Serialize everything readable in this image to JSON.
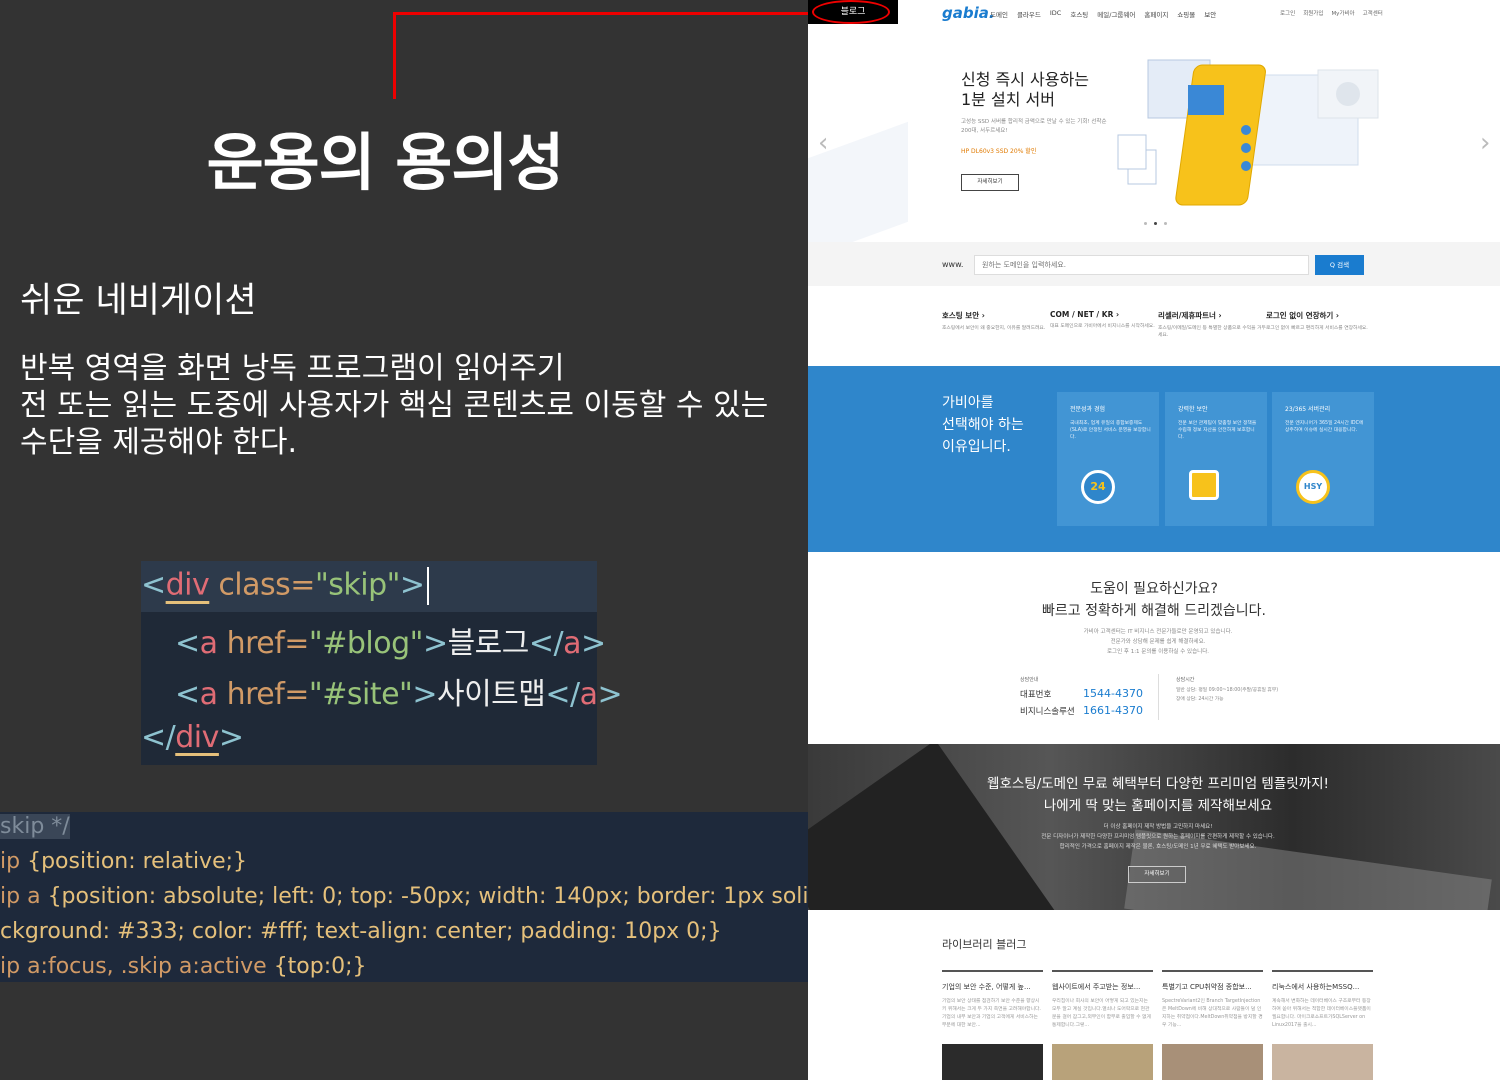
{
  "slide": {
    "title": "운용의 용의성",
    "subtitle": "쉬운 네비게이션",
    "body": [
      "반복 영역을 화면 낭독 프로그램이 읽어주기",
      "전 또는 읽는 도중에 사용자가 핵심 콘텐츠로 이동할 수 있는",
      "수단을 제공해야 한다."
    ],
    "annotation_color": "#e00000"
  },
  "html_code": {
    "line1": {
      "open": "<",
      "tag": "div",
      "attr": " class=",
      "str": "\"skip\"",
      "close": ">"
    },
    "line2": {
      "open": "<",
      "tag": "a",
      "attr": " href=",
      "str": "\"#blog\"",
      "close": ">",
      "text": "블로그",
      "end": "</",
      "endtag": "a",
      "endclose": ">"
    },
    "line3": {
      "open": "<",
      "tag": "a",
      "attr": " href=",
      "str": "\"#site\"",
      "close": ">",
      "text": "사이트맵",
      "end": "</",
      "endtag": "a",
      "endclose": ">"
    },
    "line4": {
      "open": "</",
      "tag": "div",
      "close": ">"
    }
  },
  "css_code": {
    "comment": "skip */",
    "line2": {
      "sel": "ip",
      "rest": "{position: relative;}"
    },
    "line3": {
      "sel": "ip a",
      "props": "{position: absolute; left: 0; top: -50px; width: 140px; border: 1px solid #444;"
    },
    "line4": {
      "text": "ckground: #333; color: #fff; text-align: center; padding: 10px 0;}"
    },
    "line5": {
      "sel": "ip a:focus, .skip a:active",
      "rest": "{top:0;}"
    }
  },
  "site": {
    "skip_link": "블로그",
    "logo": "gabia.",
    "gnb": [
      "도메인",
      "클라우드",
      "IDC",
      "호스팅",
      "메일/그룹웨어",
      "홈페이지",
      "쇼핑몰",
      "보안"
    ],
    "util": [
      "로그인",
      "회원가입",
      "My가비아",
      "고객센터"
    ],
    "hero": {
      "title_line1": "신청 즉시 사용하는",
      "title_line2": "1분 설치 서버",
      "desc": "고성능 SSD 서버를 합리적 금액으로 만날 수 있는 기회! 선착순 200대, 서두르세요!",
      "promo": "HP DL60v3 SSD 20% 할인",
      "button": "자세히보기"
    },
    "search": {
      "prefix": "www.",
      "placeholder": "원하는 도메인을 입력하세요.",
      "button": "Q 검색"
    },
    "quick": [
      {
        "title": "호스팅 보안 ›",
        "desc": "호스팅에서 보안이 왜 중요한지, 이유를 알려드려요."
      },
      {
        "title": "COM / NET / KR ›",
        "desc": "대표 도메인으로 가비아에서 비지니스를 시작하세요."
      },
      {
        "title": "리셀러/제휴파트너 ›",
        "desc": "호스팅/이메일/도메인 등 특별한 상품으로 수익을 거두세요."
      },
      {
        "title": "로그인 없이 연장하기 ›",
        "desc": "로그인 없이 빠르고 편리하게 서비스를 연장하세요."
      }
    ],
    "why": {
      "title": [
        "가비아를",
        "선택해야 하는",
        "이유입니다."
      ],
      "cards": [
        {
          "title": "전문성과 경험",
          "desc": "국내최초, 업계 유일의 종합보증제도(SLA)로 안정된 서비스 운영을 보장합니다.",
          "icon": "24"
        },
        {
          "title": "강력한 보안",
          "desc": "전문 보안 관제팀이 맞춤형 보안 정책을 수립해 정보 자산을 안전하게 보호합니다.",
          "icon": ""
        },
        {
          "title": "23/365 서버관리",
          "desc": "전문 엔지니어가 365일 24시간 IDC에 상주하여 이슈에 실시간 대응합니다.",
          "icon": "HSY"
        }
      ]
    },
    "help": {
      "h1": "도움이 필요하신가요?",
      "h2": "빠르고 정확하게 해결해 드리겠습니다.",
      "desc": [
        "가비아 고객센터는 IT 비지니스 전문가들로만 운영되고 있습니다.",
        "전문가와 상담해 문제를 쉽게 해결하세요.",
        "로그인 후 1:1 문의를 이용하실 수 있습니다."
      ],
      "contact_label": "상담안내",
      "rows": [
        {
          "label": "대표번호",
          "num": "1544-4370"
        },
        {
          "label": "비지니스솔루션",
          "num": "1661-4370"
        }
      ],
      "hours_label": "상담시간",
      "hours": [
        "일반 상담: 평일 09:00~18:00(주말/공휴일 휴무)",
        "장애 상담: 24시간 가능"
      ]
    },
    "promo": {
      "h1": "웹호스팅/도메인 무료 혜택부터 다양한 프리미엄 템플릿까지!",
      "h2": "나에게 딱 맞는 홈페이지를 제작해보세요",
      "desc": [
        "더 이상 홈페이지 제작 방법을 고민하지 마세요!",
        "전문 디자이너가 제작한 다양한 프리미엄 템플릿으로 원하는 홈페이지를 간편하게 제작할 수 있습니다.",
        "합리적인 가격으로 홈페이지 제작은 물론, 호스팅/도메인 1년 무료 혜택도 받아보세요."
      ],
      "button": "자세히보기"
    },
    "blog": {
      "title": "라이브러리 블러그",
      "cards": [
        {
          "title": "기업의 보안 수준, 어떻게 높...",
          "desc": "기업의 보안 상태를 점검하기 보안 수준을 향상시키 위해서는 크게 두 가지 측면을 고려해야합니다. 기업의 내부 보안과 기업의 고객에게 서비스하는 부분에 대한 보안..."
        },
        {
          "title": "웹사이트에서 주고받는 정보...",
          "desc": "우리집이나 회사의 보안이 어떻게 되고 있는지는 모두 알고 계실 것입니다.열쇠나 도어락으로 현관문을 걸어 잠그고,외부인이 함부로 출입할 수 없게 통제합니다.그렇..."
        },
        {
          "title": "특별기고 CPU취약점 종합보...",
          "desc": "SpectreVariant2인 Branch TargetInjection은 MeltDown에 비해 상대적으로 사람들이 덜 인지하는 취약점이다.MeltDown취약점을 방지할 경우 기능..."
        },
        {
          "title": "리눅스에서 사용하는MSSQ...",
          "desc": "계속해서 변화하는 데이터베이스 구조로부터 등장하여 쏟아 위해서는 적합한 데이터베이스플랫폼이 필요합니다. 마이크로소프트가SQLServer on Linux2017을 출시..."
        }
      ],
      "thumb_colors": [
        "#2b2b2b",
        "#b8a27a",
        "#a89078",
        "#c9b4a0"
      ]
    }
  }
}
